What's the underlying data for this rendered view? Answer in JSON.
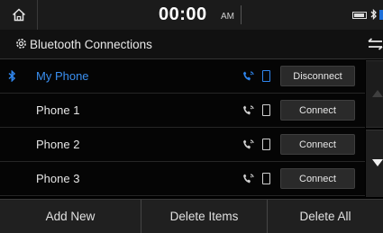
{
  "status_bar": {
    "time": "00:00",
    "ampm": "AM",
    "icons": [
      "home-icon",
      "battery-icon",
      "bluetooth-audio-icon"
    ]
  },
  "header": {
    "title": "Bluetooth Connections",
    "icons": [
      "gear-icon",
      "back-icon"
    ]
  },
  "devices": [
    {
      "name": "My Phone",
      "button": "Disconnect",
      "active": true
    },
    {
      "name": "Phone 1",
      "button": "Connect",
      "active": false
    },
    {
      "name": "Phone 2",
      "button": "Connect",
      "active": false
    },
    {
      "name": "Phone 3",
      "button": "Connect",
      "active": false
    }
  ],
  "scroll": {
    "icons": [
      "arrow-up-icon",
      "arrow-down-icon"
    ]
  },
  "bottom_actions": [
    "Add New",
    "Delete Items",
    "Delete All"
  ],
  "colors": {
    "accent": "#2f86ee",
    "background": "#000000",
    "text": "#e6e6e6"
  }
}
